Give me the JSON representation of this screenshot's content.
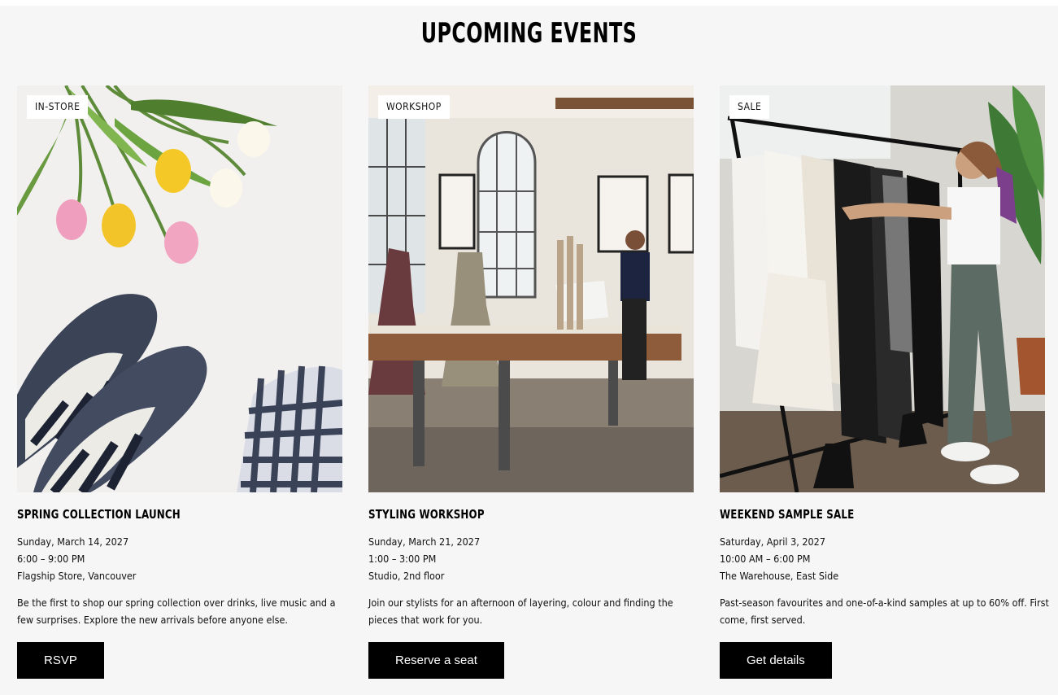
{
  "section": {
    "heading": "UPCOMING EVENTS"
  },
  "events": [
    {
      "badge": "IN-STORE",
      "image": "tulips-and-shoes-photo",
      "title": "SPRING COLLECTION LAUNCH",
      "date": "Sunday, March 14, 2027",
      "time": "6:00 – 9:00 PM",
      "location": "Flagship Store, Vancouver",
      "description": "Be the first to shop our spring collection over drinks, live music and a few surprises. Explore the new arrivals before anyone else.",
      "button": "RSVP"
    },
    {
      "badge": "WORKSHOP",
      "image": "design-studio-photo",
      "title": "STYLING WORKSHOP",
      "date": "Sunday, March 21, 2027",
      "time": "1:00 – 3:00 PM",
      "location": "Studio, 2nd floor",
      "description": "Join our stylists for an afternoon of layering, colour and finding the pieces that work for you.",
      "button": "Reserve a seat"
    },
    {
      "badge": "SALE",
      "image": "clothing-rack-photo",
      "title": "WEEKEND SAMPLE SALE",
      "date": "Saturday, April 3, 2027",
      "time": "10:00 AM – 6:00 PM",
      "location": "The Warehouse, East Side",
      "description": "Past-season favourites and one-of-a-kind samples at up to 60% off. First come, first served.",
      "button": "Get details"
    }
  ]
}
